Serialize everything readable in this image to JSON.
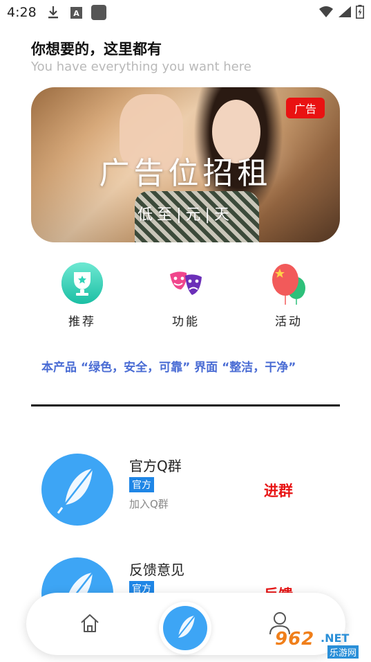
{
  "status_bar": {
    "time": "4:28",
    "icons_left": [
      "download-icon",
      "a-badge-icon",
      "square-icon"
    ],
    "icons_right": [
      "wifi-icon",
      "signal-icon",
      "battery-charging-icon"
    ]
  },
  "header": {
    "title": "你想要的，这里都有",
    "subtitle": "You have everything you want here"
  },
  "banner": {
    "tag": "广告",
    "headline": "广告位招租",
    "subline": "低至|元|天"
  },
  "features": [
    {
      "label": "推荐",
      "icon": "trophy-icon"
    },
    {
      "label": "功能",
      "icon": "theater-masks-icon"
    },
    {
      "label": "活动",
      "icon": "balloons-icon"
    }
  ],
  "slogan": "本产品 “绿色，安全，可靠”   界面 “整洁，干净”",
  "list": [
    {
      "name": "官方Q群",
      "badge": "官方",
      "desc": "加入Q群",
      "action": "进群",
      "icon": "feather-icon"
    },
    {
      "name": "反馈意见",
      "badge": "官方",
      "desc": "",
      "action": "反馈",
      "icon": "feather-icon"
    }
  ],
  "bottom_nav": {
    "items": [
      "home-icon",
      "feather-icon",
      "user-icon"
    ]
  },
  "watermark": {
    "number": "962",
    "domain": ".NET",
    "site": "乐游网"
  },
  "colors": {
    "accent_blue": "#3da5f5",
    "badge_blue": "#1f86e6",
    "action_red": "#e81515",
    "slogan_blue": "#4a6cd4",
    "ad_tag_red": "#e91212"
  }
}
